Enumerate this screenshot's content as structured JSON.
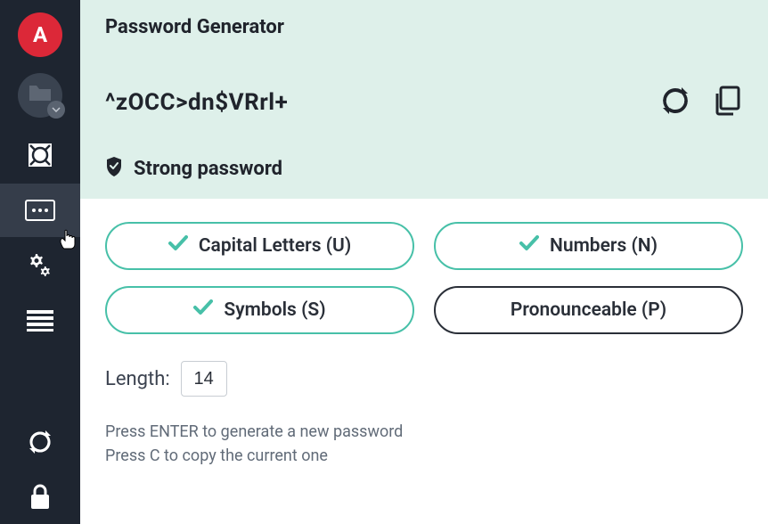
{
  "sidebar": {
    "avatar_letter": "A"
  },
  "header": {
    "title": "Password Generator",
    "password": "^zOCC>dn$VRrl+",
    "strength_label": "Strong password"
  },
  "toggles": {
    "capital": {
      "label": "Capital Letters (U)",
      "on": true
    },
    "numbers": {
      "label": "Numbers (N)",
      "on": true
    },
    "symbols": {
      "label": "Symbols (S)",
      "on": true
    },
    "pronounceable": {
      "label": "Pronounceable (P)",
      "on": false
    }
  },
  "length": {
    "label": "Length:",
    "value": "14"
  },
  "hints": {
    "line1": "Press ENTER to generate a new password",
    "line2": "Press C to copy the current one"
  }
}
